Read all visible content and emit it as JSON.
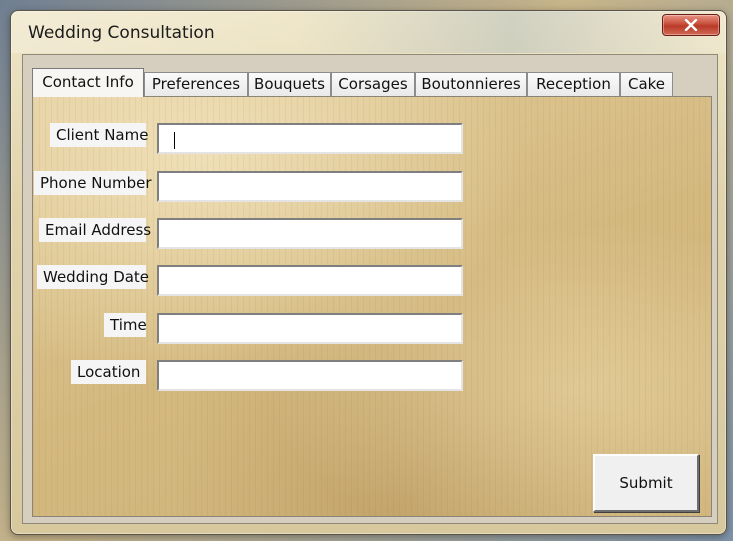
{
  "window": {
    "title": "Wedding Consultation"
  },
  "tabs": [
    {
      "label": "Contact Info",
      "active": true
    },
    {
      "label": "Preferences",
      "active": false
    },
    {
      "label": "Bouquets",
      "active": false
    },
    {
      "label": "Corsages",
      "active": false
    },
    {
      "label": "Boutonnieres",
      "active": false
    },
    {
      "label": "Reception",
      "active": false
    },
    {
      "label": "Cake",
      "active": false
    }
  ],
  "form": {
    "fields": [
      {
        "label": "Client Name",
        "value": "",
        "placeholder": ""
      },
      {
        "label": "Phone Number",
        "value": "",
        "placeholder": ""
      },
      {
        "label": "Email Address",
        "value": "",
        "placeholder": ""
      },
      {
        "label": "Wedding Date",
        "value": "",
        "placeholder": ""
      },
      {
        "label": "Time",
        "value": "",
        "placeholder": ""
      },
      {
        "label": "Location",
        "value": "",
        "placeholder": ""
      }
    ],
    "submit_label": "Submit"
  },
  "icons": {
    "close": "close-x-icon"
  },
  "colors": {
    "close_button": "#c84f3b",
    "panel_paper": "#d8c08c"
  }
}
